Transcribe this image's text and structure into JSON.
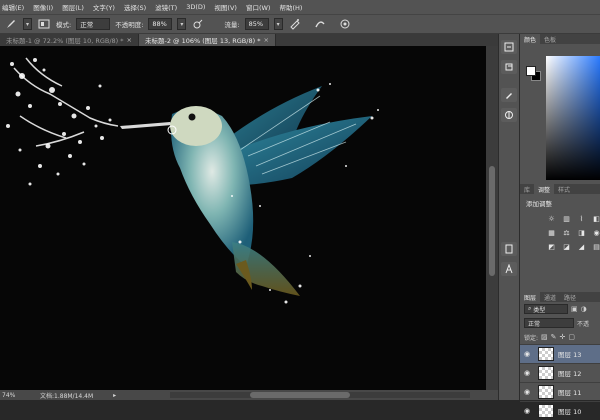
{
  "menu": [
    "编辑(E)",
    "图像(I)",
    "图层(L)",
    "文字(Y)",
    "选择(S)",
    "滤镜(T)",
    "3D(D)",
    "视图(V)",
    "窗口(W)",
    "帮助(H)"
  ],
  "options": {
    "mode_label": "模式:",
    "mode_value": "正常",
    "opacity_label": "不透明度:",
    "opacity_value": "88%",
    "flow_label": "流量:",
    "flow_value": "85%"
  },
  "doc_tabs": [
    {
      "label": "未标题-1 @ 72.2% (图层 10, RGB/8) *",
      "active": false
    },
    {
      "label": "未标题-2 @ 106% (图层 13, RGB/8) *",
      "active": true
    }
  ],
  "status": {
    "zoom": "74%",
    "doc_info": "文档:1.88M/14.4M",
    "arrow": "▸"
  },
  "panels": {
    "color_tabs": [
      "颜色",
      "色板"
    ],
    "adjust_tabs": [
      "库",
      "调整",
      "样式"
    ],
    "adjust_title": "添加调整",
    "layer_tabs": [
      "图层",
      "通道",
      "路径"
    ],
    "filter_kind": "类型",
    "blend_mode": "正常",
    "opacity_short": "不透",
    "lock_label": "锁定:",
    "layers": [
      {
        "name": "图层 13",
        "selected": true
      },
      {
        "name": "图层 12",
        "selected": false
      },
      {
        "name": "图层 11",
        "selected": false
      },
      {
        "name": "图层 10",
        "selected": false
      }
    ]
  },
  "colors": {
    "foreground": "#ffffff",
    "background": "#000000",
    "panel_bg": "#535353",
    "selected_layer": "#5e6e88"
  }
}
